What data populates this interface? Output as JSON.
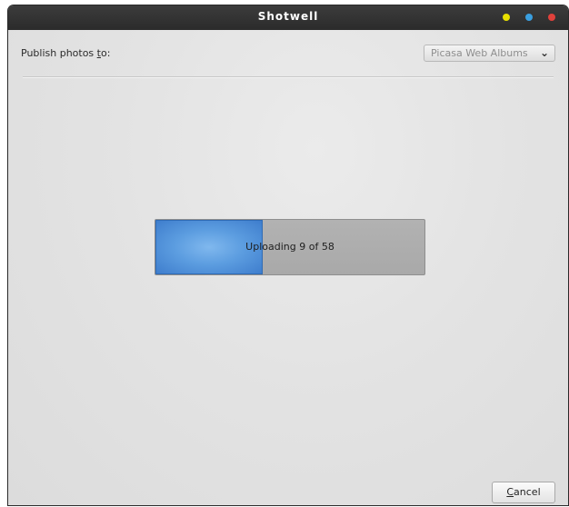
{
  "window": {
    "title": "Shotwell",
    "controls": [
      {
        "name": "minimize",
        "color": "#e8e000"
      },
      {
        "name": "maximize",
        "color": "#3a9fe0"
      },
      {
        "name": "close",
        "color": "#e0413b"
      }
    ]
  },
  "publish": {
    "label_prefix": "Publish photos ",
    "label_mnemonic": "t",
    "label_suffix": "o:",
    "service_selected": "Picasa Web Albums",
    "dropdown_icon": "chevron-down-icon"
  },
  "progress": {
    "text": "Uploading 9 of 58",
    "current": 9,
    "total": 58,
    "fraction": 0.4,
    "fill_color": "#5c9de0"
  },
  "buttons": {
    "cancel_mnemonic": "C",
    "cancel_rest": "ancel"
  }
}
